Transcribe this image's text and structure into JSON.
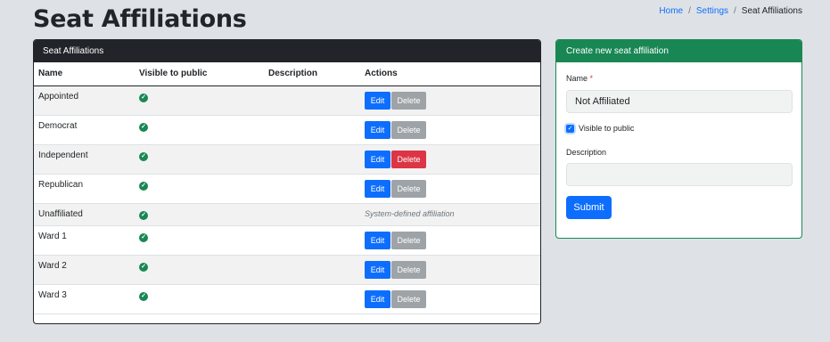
{
  "header": {
    "title": "Seat Affiliations",
    "breadcrumb": [
      "Home",
      "Settings",
      "Seat Affiliations"
    ]
  },
  "list_card": {
    "title": "Seat Affiliations",
    "columns": [
      "Name",
      "Visible to public",
      "Description",
      "Actions"
    ],
    "edit_label": "Edit",
    "delete_label": "Delete",
    "system_note": "System-defined affiliation",
    "rows": [
      {
        "name": "Appointed",
        "visible": true,
        "description": ""
      },
      {
        "name": "Democrat",
        "visible": true,
        "description": ""
      },
      {
        "name": "Independent",
        "visible": true,
        "description": ""
      },
      {
        "name": "Republican",
        "visible": true,
        "description": ""
      },
      {
        "name": "Unaffiliated",
        "visible": true,
        "description": ""
      },
      {
        "name": "Ward 1",
        "visible": true,
        "description": ""
      },
      {
        "name": "Ward 2",
        "visible": true,
        "description": ""
      },
      {
        "name": "Ward 3",
        "visible": true,
        "description": ""
      }
    ]
  },
  "form_card": {
    "title": "Create new seat affiliation",
    "name_label": "Name",
    "required_mark": "*",
    "name_value": "Not Affiliated",
    "visible_label": "Visible to public",
    "visible_checked": true,
    "description_label": "Description",
    "description_value": "",
    "submit_label": "Submit"
  },
  "colors": {
    "list_header": "#212529",
    "form_header": "#198754",
    "primary": "#0d6efd",
    "danger": "#dc3545",
    "secondary": "#9ea3a8"
  },
  "icons": {
    "visible": "check-circle-icon",
    "checkbox": "checkmark-icon"
  }
}
